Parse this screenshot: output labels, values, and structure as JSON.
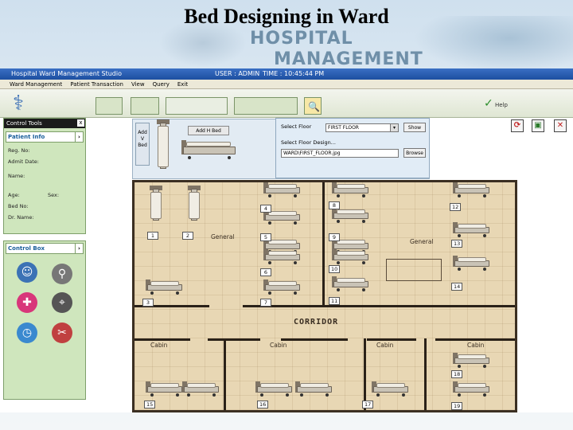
{
  "slide": {
    "title": "Bed Designing in Ward"
  },
  "banner": {
    "line1": "HOSPITAL",
    "line2": "MANAGEMENT"
  },
  "app": {
    "window_title": "Hospital Ward Management Studio",
    "user": "USER : ADMIN",
    "time": "TIME : 10:45:44 PM",
    "menu": [
      "Ward Management",
      "Patient Transaction",
      "View",
      "Query",
      "Exit"
    ],
    "help_label": "Help"
  },
  "control_tools": {
    "header": "Control Tools",
    "close": "x",
    "patient_info": {
      "title": "Patient Info",
      "fields": [
        {
          "label": "Reg. No:",
          "extra": ""
        },
        {
          "label": "Admit Date:",
          "extra": ""
        },
        {
          "label": "Name:",
          "extra": ""
        },
        {
          "label": "Age:",
          "extra": "Sex:"
        },
        {
          "label": "Bed No:",
          "extra": ""
        },
        {
          "label": "Dr. Name:",
          "extra": ""
        }
      ]
    }
  },
  "control_box": {
    "title": "Control Box",
    "icons": [
      "doctor-icon",
      "stethoscope-icon",
      "medicine-icon",
      "microscope-icon",
      "clock-icon",
      "tools-icon"
    ]
  },
  "design_tools": {
    "add_bed_label": "Add H Bed",
    "add_v_bed_label": "Add V Bed",
    "select_floor_label": "Select Floor",
    "floor_value": "FIRST FLOOR",
    "show_label": "Show",
    "select_design_label": "Select Floor Design...",
    "design_path": "WARD\\FIRST_FLOOR.jpg",
    "browse_label": "Browse"
  },
  "floor_plan": {
    "corridor_label": "CORRIDOR",
    "zones": [
      "General",
      "General",
      "Cabin",
      "Cabin",
      "Cabin",
      "Cabin"
    ],
    "bed_numbers": [
      "1",
      "2",
      "4",
      "5",
      "6",
      "7",
      "3",
      "8",
      "9",
      "10",
      "11",
      "12",
      "13",
      "14",
      "15",
      "16",
      "17",
      "18",
      "19"
    ]
  }
}
